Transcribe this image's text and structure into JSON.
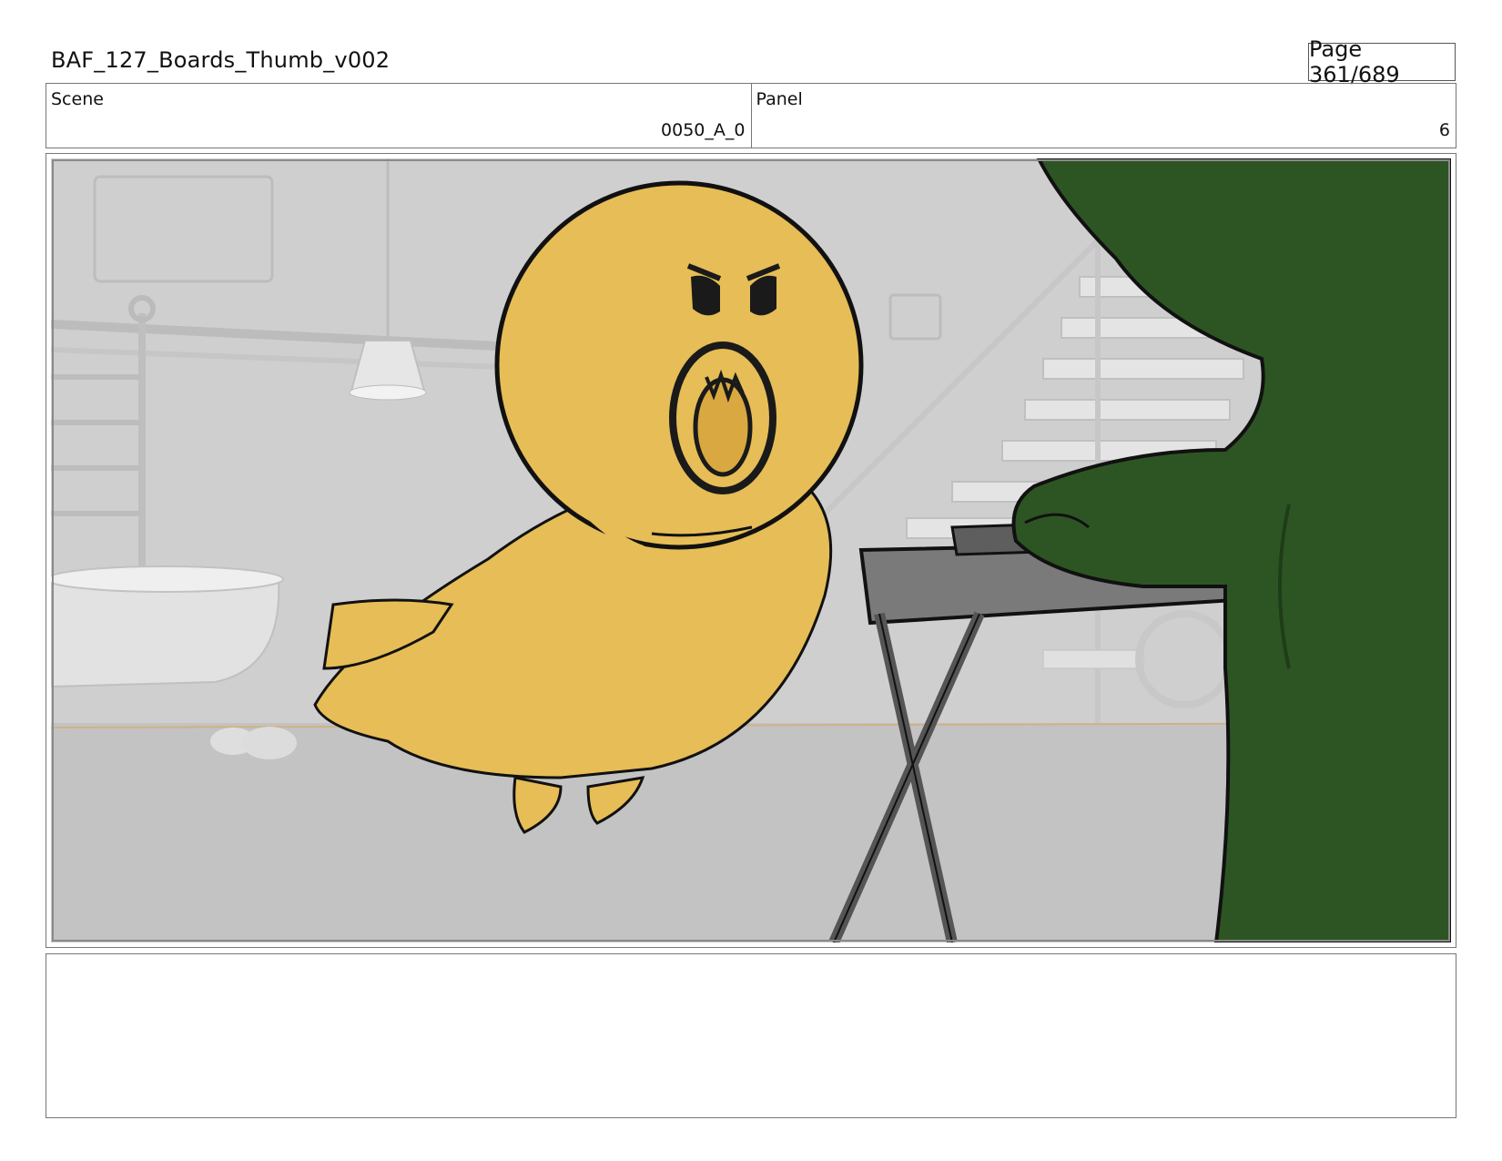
{
  "document": {
    "title": "BAF_127_Boards_Thumb_v002",
    "page_label": "Page 361/689"
  },
  "info": {
    "scene_label": "Scene",
    "scene_value": "0050_A_0",
    "panel_label": "Panel",
    "panel_value": "6"
  },
  "colors": {
    "background_gray": "#d4d4d4",
    "chick_yellow": "#e6bd56",
    "green_character": "#2d5524",
    "keyboard_gray": "#777777"
  },
  "notes": {
    "text": ""
  }
}
